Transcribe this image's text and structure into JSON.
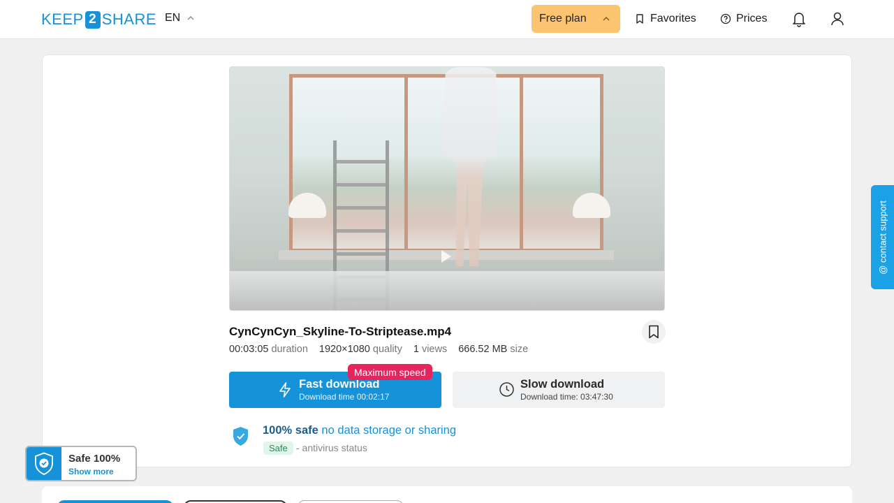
{
  "header": {
    "logo": {
      "pre": "KEEP",
      "num": "2",
      "post": "SHARE"
    },
    "language": "EN",
    "plan_label": "Free plan",
    "favorites_label": "Favorites",
    "prices_label": "Prices"
  },
  "file": {
    "name": "CynCynCyn_Skyline-To-Striptease.mp4",
    "duration_value": "00:03:05",
    "duration_label": "duration",
    "quality_value": "1920×1080",
    "quality_label": "quality",
    "views_value": "1",
    "views_label": "views",
    "size_value": "666.52 MB",
    "size_label": "size"
  },
  "downloads": {
    "fast_label": "Fast download",
    "fast_time": "Download time 00:02:17",
    "badge": "Maximum speed",
    "slow_label": "Slow download",
    "slow_time": "Download time: 03:47:30"
  },
  "safety": {
    "strong": "100% safe",
    "rest": "no data storage or sharing",
    "tag": "Safe",
    "status": "- antivirus status"
  },
  "safe_widget": {
    "title": "Safe 100%",
    "more": "Show more"
  },
  "contact_label": "@ contact support",
  "colors": {
    "brand": "#1592d8",
    "plan": "#fcc470",
    "badge": "#e6245e",
    "contact": "#1ba1e6"
  },
  "icons": [
    "chevron-up-icon",
    "bookmark-icon",
    "question-circle-icon",
    "bell-icon",
    "user-icon",
    "lightning-icon",
    "clock-icon",
    "shield-check-icon",
    "play-icon"
  ]
}
